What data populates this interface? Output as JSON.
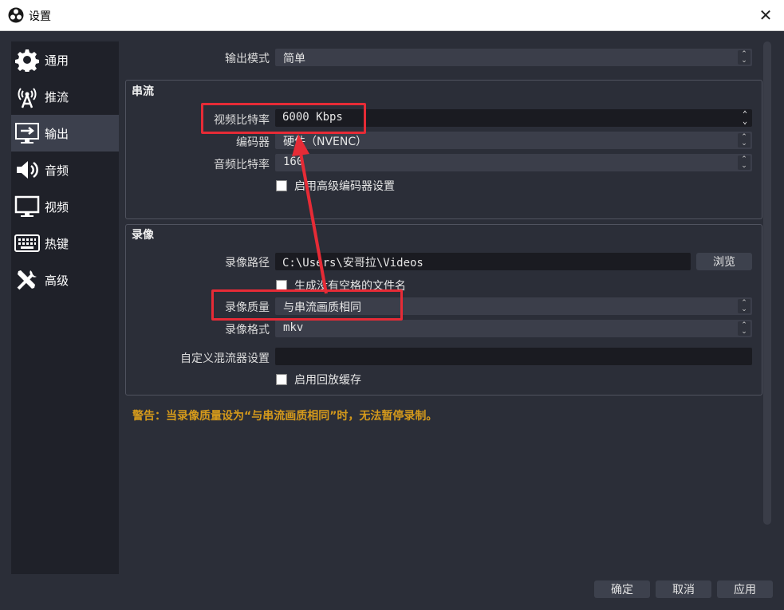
{
  "window": {
    "title": "设置",
    "close_symbol": "✕"
  },
  "sidebar": {
    "items": [
      {
        "label": "通用",
        "icon": "gear-icon"
      },
      {
        "label": "推流",
        "icon": "broadcast-antenna-icon"
      },
      {
        "label": "输出",
        "icon": "output-monitor-icon"
      },
      {
        "label": "音频",
        "icon": "speaker-icon"
      },
      {
        "label": "视频",
        "icon": "monitor-icon"
      },
      {
        "label": "热键",
        "icon": "keyboard-icon"
      },
      {
        "label": "高级",
        "icon": "tools-icon"
      }
    ],
    "active_index": 2
  },
  "output_mode": {
    "label": "输出模式",
    "value": "简单"
  },
  "streaming": {
    "title": "串流",
    "video_bitrate": {
      "label": "视频比特率",
      "value": "6000 Kbps"
    },
    "encoder": {
      "label": "编码器",
      "value": "硬件（NVENC）"
    },
    "audio_bitrate": {
      "label": "音频比特率",
      "value": "160"
    },
    "advanced_encoder": {
      "label": "启用高级编码器设置",
      "checked": false
    }
  },
  "recording": {
    "title": "录像",
    "path": {
      "label": "录像路径",
      "value": "C:\\Users\\安哥拉\\Videos"
    },
    "browse_label": "浏览",
    "no_space_filename": {
      "label": "生成没有空格的文件名",
      "checked": false
    },
    "quality": {
      "label": "录像质量",
      "value": "与串流画质相同"
    },
    "format": {
      "label": "录像格式",
      "value": "mkv"
    },
    "muxer": {
      "label": "自定义混流器设置",
      "value": ""
    },
    "replay_buffer": {
      "label": "启用回放缓存",
      "checked": false
    }
  },
  "warning": "警告：当录像质量设为“与串流画质相同”时，无法暂停录制。",
  "buttons": {
    "ok": "确定",
    "cancel": "取消",
    "apply": "应用"
  },
  "colors": {
    "warning": "#d59a1b",
    "highlight": "#e62b36",
    "background": "#2b2e38"
  }
}
